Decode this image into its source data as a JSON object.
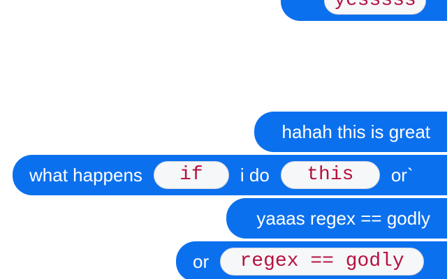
{
  "colors": {
    "bubble_background": "#0b70ee",
    "bubble_text": "#ffffff",
    "code_background": "#f6f7f9",
    "code_border": "#d5d7dc",
    "code_text": "#b5123f",
    "page_background": "#ffffff"
  },
  "messages": [
    {
      "parts": [
        {
          "type": "code",
          "text": "yesssss"
        }
      ]
    },
    {
      "parts": [
        {
          "type": "text",
          "text": "hahah this is great"
        }
      ]
    },
    {
      "parts": [
        {
          "type": "text",
          "text": "what happens"
        },
        {
          "type": "code",
          "text": "if"
        },
        {
          "type": "text",
          "text": "i do"
        },
        {
          "type": "code",
          "text": "this"
        },
        {
          "type": "text",
          "text": "or`"
        }
      ]
    },
    {
      "parts": [
        {
          "type": "text",
          "text": "yaaas regex == godly"
        }
      ]
    },
    {
      "parts": [
        {
          "type": "text",
          "text": "or"
        },
        {
          "type": "code",
          "text": "regex == godly"
        }
      ]
    }
  ]
}
